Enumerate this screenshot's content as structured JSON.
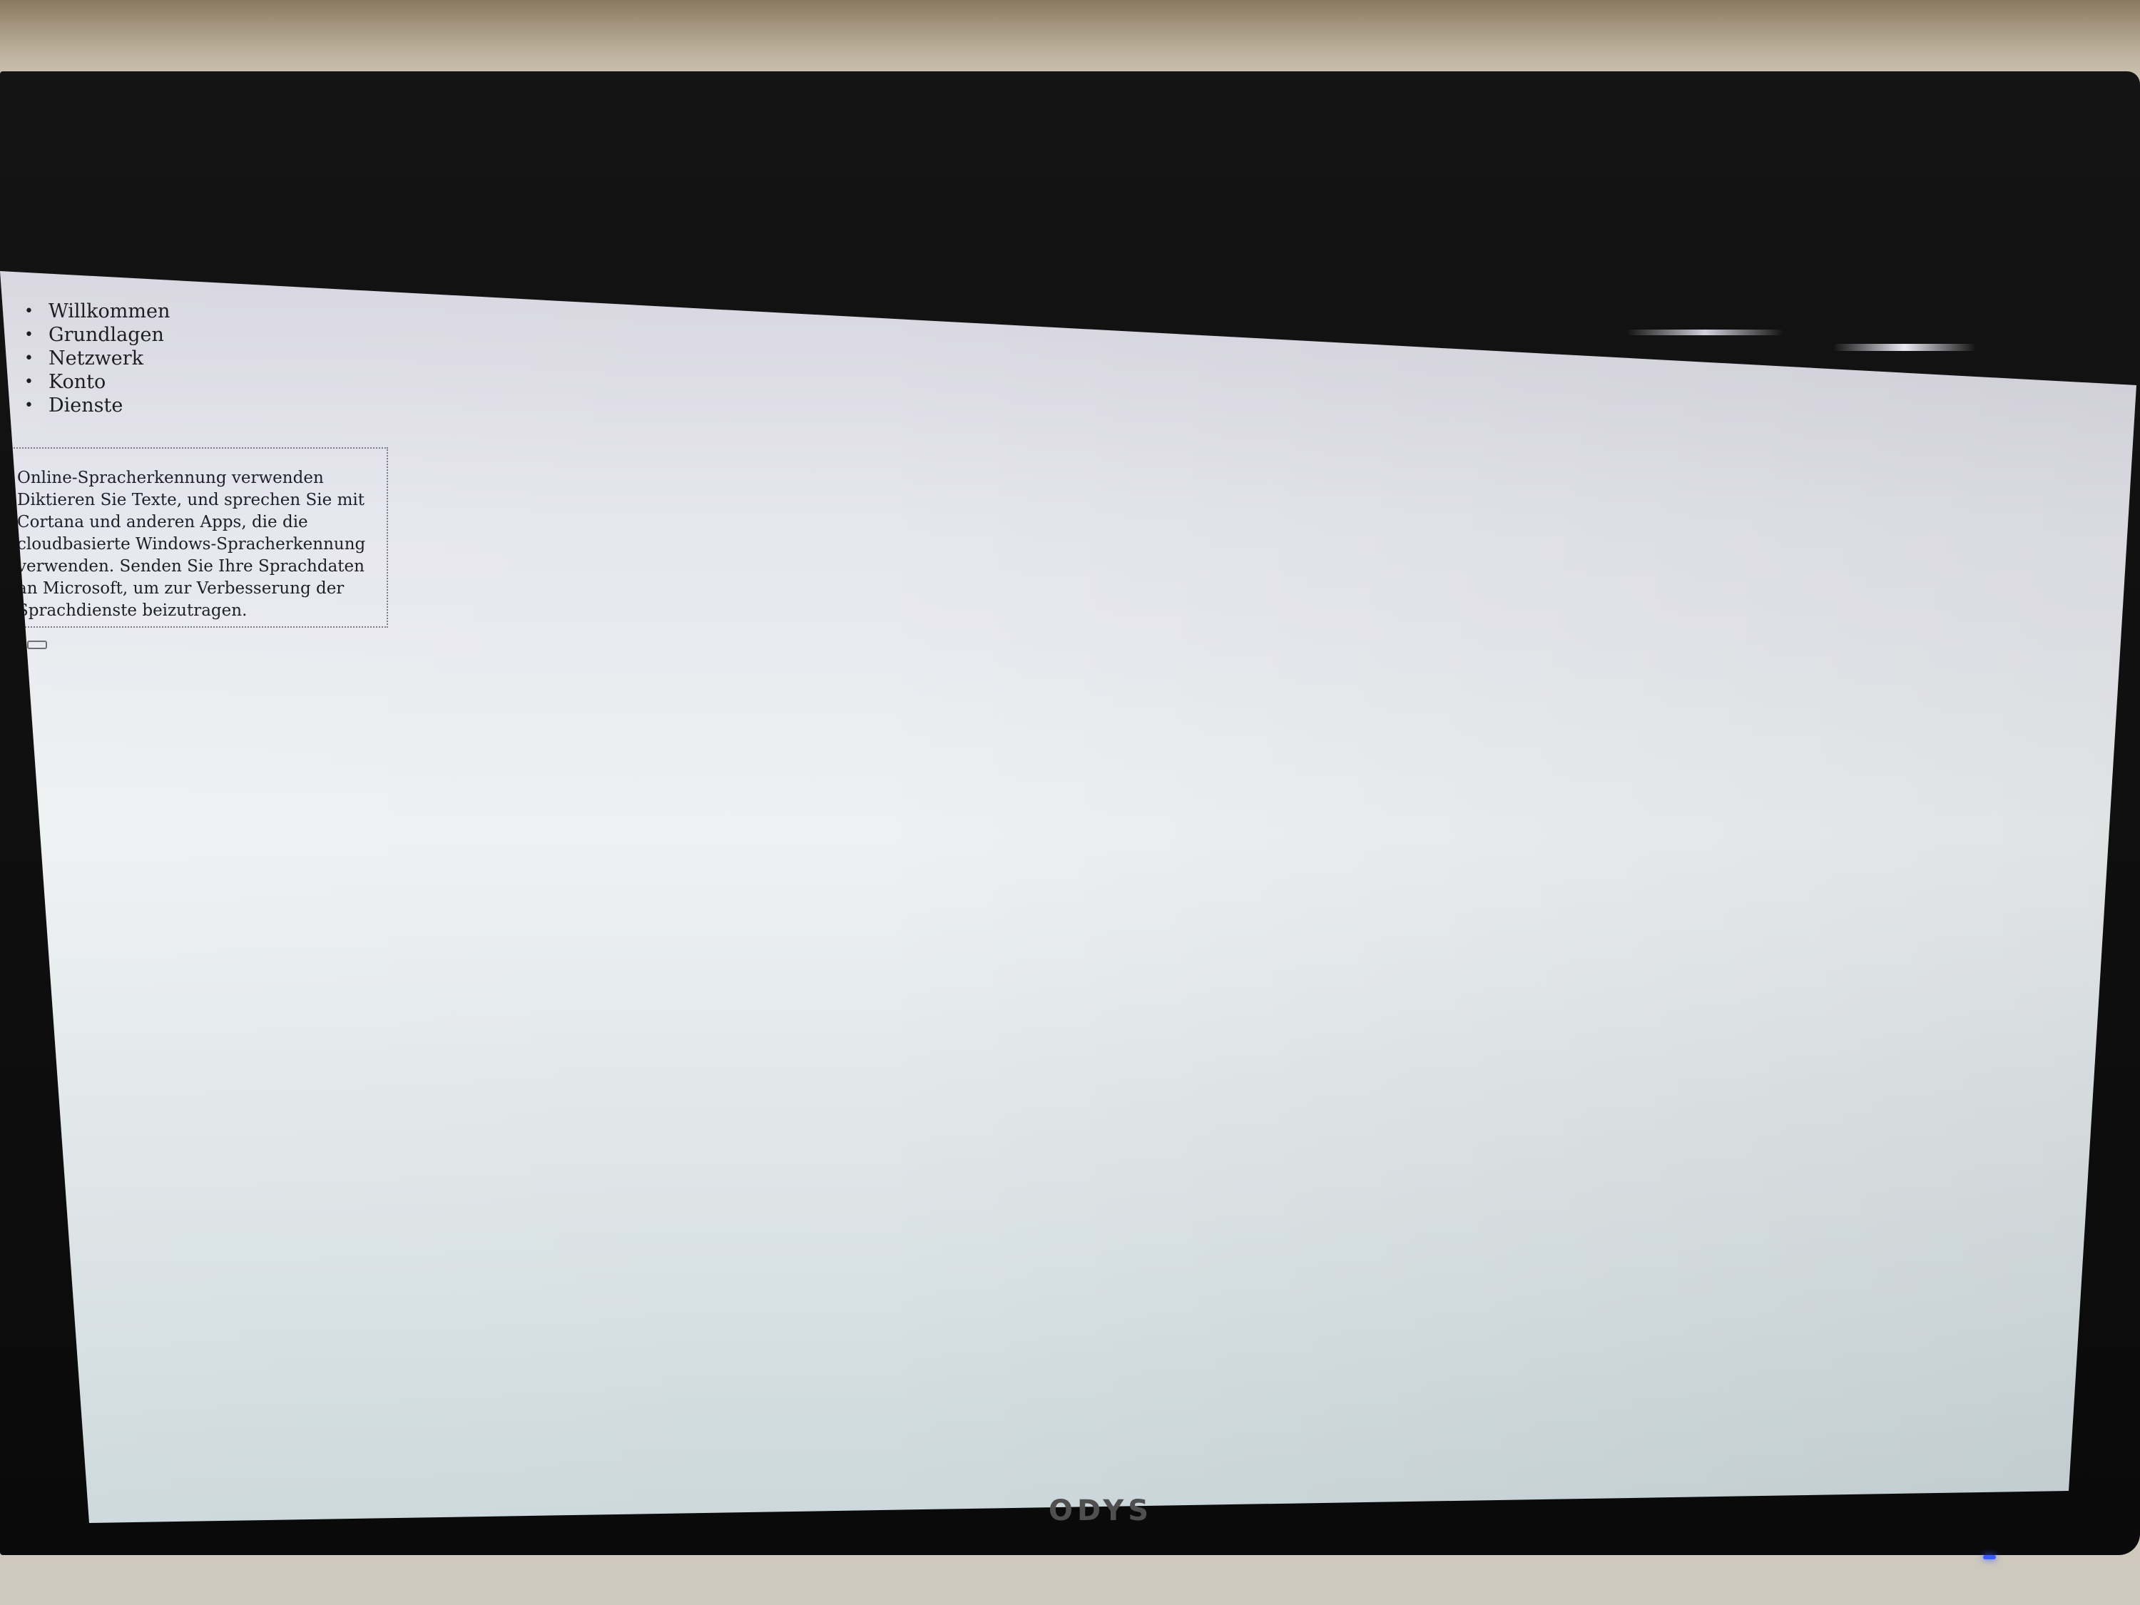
{
  "nav": {
    "items": [
      {
        "label": "Willkommen"
      },
      {
        "label": "Grundlagen"
      },
      {
        "label": "Netzwerk"
      },
      {
        "label": "Konto"
      },
      {
        "label": "Dienste"
      }
    ]
  },
  "card": {
    "title": "Online-Spracherkennung verwenden",
    "description": "Diktieren Sie Texte, und sprechen Sie mit Cortana und anderen Apps, die die cloudbasierte Windows-Spracherkennung verwenden. Senden Sie Ihre Sprachdaten an Microsoft, um zur Verbesserung der Sprachdienste beizutragen."
  },
  "monitor": {
    "brand_logo": "ODYS"
  },
  "colors": {
    "power_led": "#3a5cff"
  }
}
